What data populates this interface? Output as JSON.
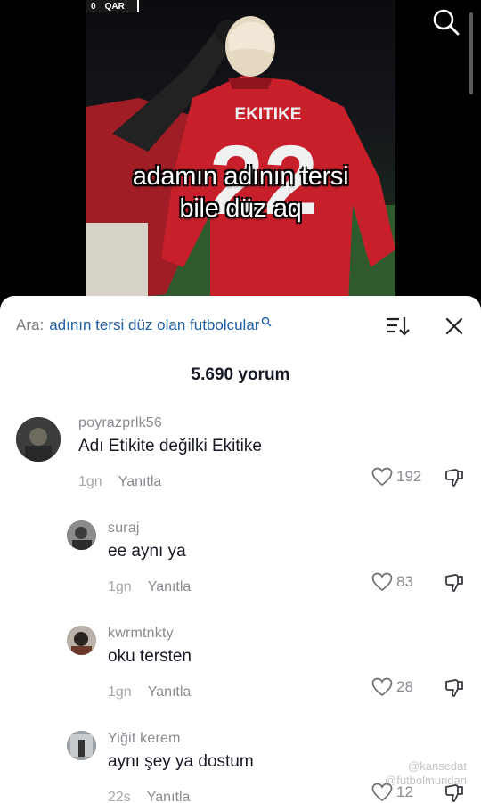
{
  "video": {
    "scoreboard": [
      "0",
      "QAR"
    ],
    "jersey_name": "EKITIKE",
    "jersey_number": "22",
    "caption_line1": "adamın adının tersi",
    "caption_line2": "bile düz aq"
  },
  "search_button_icon": "search-icon",
  "sheet": {
    "search_prefix": "Ara:",
    "search_query": "adının tersi düz olan futbolcular",
    "search_icon": "search-icon",
    "sort_icon": "sort-icon",
    "close_icon": "close-icon",
    "comment_count": "5.690 yorum"
  },
  "comments": [
    {
      "user": "poyrazprlk56",
      "text": "Adı Etikite değilki Ekitike",
      "time": "1gn",
      "reply": "Yanıtla",
      "likes": "192"
    },
    {
      "user": "suraj",
      "text": "ee aynı ya",
      "time": "1gn",
      "reply": "Yanıtla",
      "likes": "83"
    },
    {
      "user": "kwrmtnkty",
      "text": "oku tersten",
      "time": "1gn",
      "reply": "Yanıtla",
      "likes": "28"
    },
    {
      "user": "Yiğit kerem",
      "text": "aynı şey ya dostum",
      "time": "22s",
      "reply": "Yanıtla",
      "likes": "12"
    }
  ],
  "watermark": {
    "line1": "@kansedat",
    "line2": "@futbolmundan"
  },
  "colors": {
    "link_blue": "#1f5fa8",
    "muted": "#8a8b91",
    "text": "#161823"
  }
}
